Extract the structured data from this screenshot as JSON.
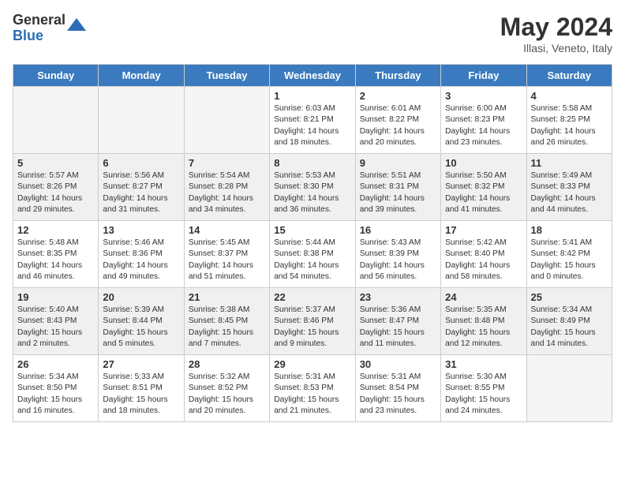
{
  "header": {
    "logo_general": "General",
    "logo_blue": "Blue",
    "month_year": "May 2024",
    "location": "Illasi, Veneto, Italy"
  },
  "days_of_week": [
    "Sunday",
    "Monday",
    "Tuesday",
    "Wednesday",
    "Thursday",
    "Friday",
    "Saturday"
  ],
  "weeks": [
    [
      {
        "day": "",
        "empty": true
      },
      {
        "day": "",
        "empty": true
      },
      {
        "day": "",
        "empty": true
      },
      {
        "day": "1",
        "sunrise": "6:03 AM",
        "sunset": "8:21 PM",
        "daylight": "14 hours and 18 minutes.",
        "shaded": false
      },
      {
        "day": "2",
        "sunrise": "6:01 AM",
        "sunset": "8:22 PM",
        "daylight": "14 hours and 20 minutes.",
        "shaded": false
      },
      {
        "day": "3",
        "sunrise": "6:00 AM",
        "sunset": "8:23 PM",
        "daylight": "14 hours and 23 minutes.",
        "shaded": false
      },
      {
        "day": "4",
        "sunrise": "5:58 AM",
        "sunset": "8:25 PM",
        "daylight": "14 hours and 26 minutes.",
        "shaded": false
      }
    ],
    [
      {
        "day": "5",
        "sunrise": "5:57 AM",
        "sunset": "8:26 PM",
        "daylight": "14 hours and 29 minutes.",
        "shaded": true
      },
      {
        "day": "6",
        "sunrise": "5:56 AM",
        "sunset": "8:27 PM",
        "daylight": "14 hours and 31 minutes.",
        "shaded": true
      },
      {
        "day": "7",
        "sunrise": "5:54 AM",
        "sunset": "8:28 PM",
        "daylight": "14 hours and 34 minutes.",
        "shaded": true
      },
      {
        "day": "8",
        "sunrise": "5:53 AM",
        "sunset": "8:30 PM",
        "daylight": "14 hours and 36 minutes.",
        "shaded": true
      },
      {
        "day": "9",
        "sunrise": "5:51 AM",
        "sunset": "8:31 PM",
        "daylight": "14 hours and 39 minutes.",
        "shaded": true
      },
      {
        "day": "10",
        "sunrise": "5:50 AM",
        "sunset": "8:32 PM",
        "daylight": "14 hours and 41 minutes.",
        "shaded": true
      },
      {
        "day": "11",
        "sunrise": "5:49 AM",
        "sunset": "8:33 PM",
        "daylight": "14 hours and 44 minutes.",
        "shaded": true
      }
    ],
    [
      {
        "day": "12",
        "sunrise": "5:48 AM",
        "sunset": "8:35 PM",
        "daylight": "14 hours and 46 minutes.",
        "shaded": false
      },
      {
        "day": "13",
        "sunrise": "5:46 AM",
        "sunset": "8:36 PM",
        "daylight": "14 hours and 49 minutes.",
        "shaded": false
      },
      {
        "day": "14",
        "sunrise": "5:45 AM",
        "sunset": "8:37 PM",
        "daylight": "14 hours and 51 minutes.",
        "shaded": false
      },
      {
        "day": "15",
        "sunrise": "5:44 AM",
        "sunset": "8:38 PM",
        "daylight": "14 hours and 54 minutes.",
        "shaded": false
      },
      {
        "day": "16",
        "sunrise": "5:43 AM",
        "sunset": "8:39 PM",
        "daylight": "14 hours and 56 minutes.",
        "shaded": false
      },
      {
        "day": "17",
        "sunrise": "5:42 AM",
        "sunset": "8:40 PM",
        "daylight": "14 hours and 58 minutes.",
        "shaded": false
      },
      {
        "day": "18",
        "sunrise": "5:41 AM",
        "sunset": "8:42 PM",
        "daylight": "15 hours and 0 minutes.",
        "shaded": false
      }
    ],
    [
      {
        "day": "19",
        "sunrise": "5:40 AM",
        "sunset": "8:43 PM",
        "daylight": "15 hours and 2 minutes.",
        "shaded": true
      },
      {
        "day": "20",
        "sunrise": "5:39 AM",
        "sunset": "8:44 PM",
        "daylight": "15 hours and 5 minutes.",
        "shaded": true
      },
      {
        "day": "21",
        "sunrise": "5:38 AM",
        "sunset": "8:45 PM",
        "daylight": "15 hours and 7 minutes.",
        "shaded": true
      },
      {
        "day": "22",
        "sunrise": "5:37 AM",
        "sunset": "8:46 PM",
        "daylight": "15 hours and 9 minutes.",
        "shaded": true
      },
      {
        "day": "23",
        "sunrise": "5:36 AM",
        "sunset": "8:47 PM",
        "daylight": "15 hours and 11 minutes.",
        "shaded": true
      },
      {
        "day": "24",
        "sunrise": "5:35 AM",
        "sunset": "8:48 PM",
        "daylight": "15 hours and 12 minutes.",
        "shaded": true
      },
      {
        "day": "25",
        "sunrise": "5:34 AM",
        "sunset": "8:49 PM",
        "daylight": "15 hours and 14 minutes.",
        "shaded": true
      }
    ],
    [
      {
        "day": "26",
        "sunrise": "5:34 AM",
        "sunset": "8:50 PM",
        "daylight": "15 hours and 16 minutes.",
        "shaded": false
      },
      {
        "day": "27",
        "sunrise": "5:33 AM",
        "sunset": "8:51 PM",
        "daylight": "15 hours and 18 minutes.",
        "shaded": false
      },
      {
        "day": "28",
        "sunrise": "5:32 AM",
        "sunset": "8:52 PM",
        "daylight": "15 hours and 20 minutes.",
        "shaded": false
      },
      {
        "day": "29",
        "sunrise": "5:31 AM",
        "sunset": "8:53 PM",
        "daylight": "15 hours and 21 minutes.",
        "shaded": false
      },
      {
        "day": "30",
        "sunrise": "5:31 AM",
        "sunset": "8:54 PM",
        "daylight": "15 hours and 23 minutes.",
        "shaded": false
      },
      {
        "day": "31",
        "sunrise": "5:30 AM",
        "sunset": "8:55 PM",
        "daylight": "15 hours and 24 minutes.",
        "shaded": false
      },
      {
        "day": "",
        "empty": true
      }
    ]
  ]
}
